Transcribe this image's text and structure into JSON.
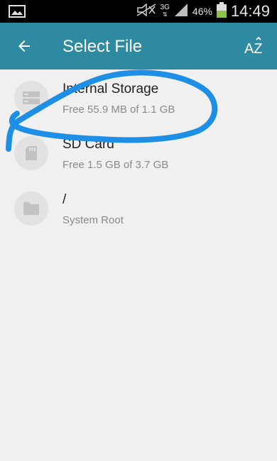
{
  "status_bar": {
    "network_type": "3G",
    "battery_percent": "46%",
    "time": "14:49",
    "icons": [
      "gallery-icon",
      "muted-icon",
      "signal-icon",
      "battery-icon"
    ]
  },
  "app_bar": {
    "title": "Select File",
    "back_icon": "arrow-left-icon",
    "sort_label": "AZ",
    "background_color": "#2d8aa1"
  },
  "items": [
    {
      "title": "Internal Storage",
      "subtitle": "Free 55.9 MB of 1.1 GB",
      "icon": "storage-icon"
    },
    {
      "title": "SD Card",
      "subtitle": "Free 1.5 GB of 3.7 GB",
      "icon": "sd-card-icon"
    },
    {
      "title": "/",
      "subtitle": "System Root",
      "icon": "folder-icon"
    }
  ],
  "colors": {
    "accent": "#2d8aa1",
    "annotation": "#1e8fe6",
    "icon_bg": "#e2e2e2",
    "icon_fg": "#c2c2c2"
  }
}
